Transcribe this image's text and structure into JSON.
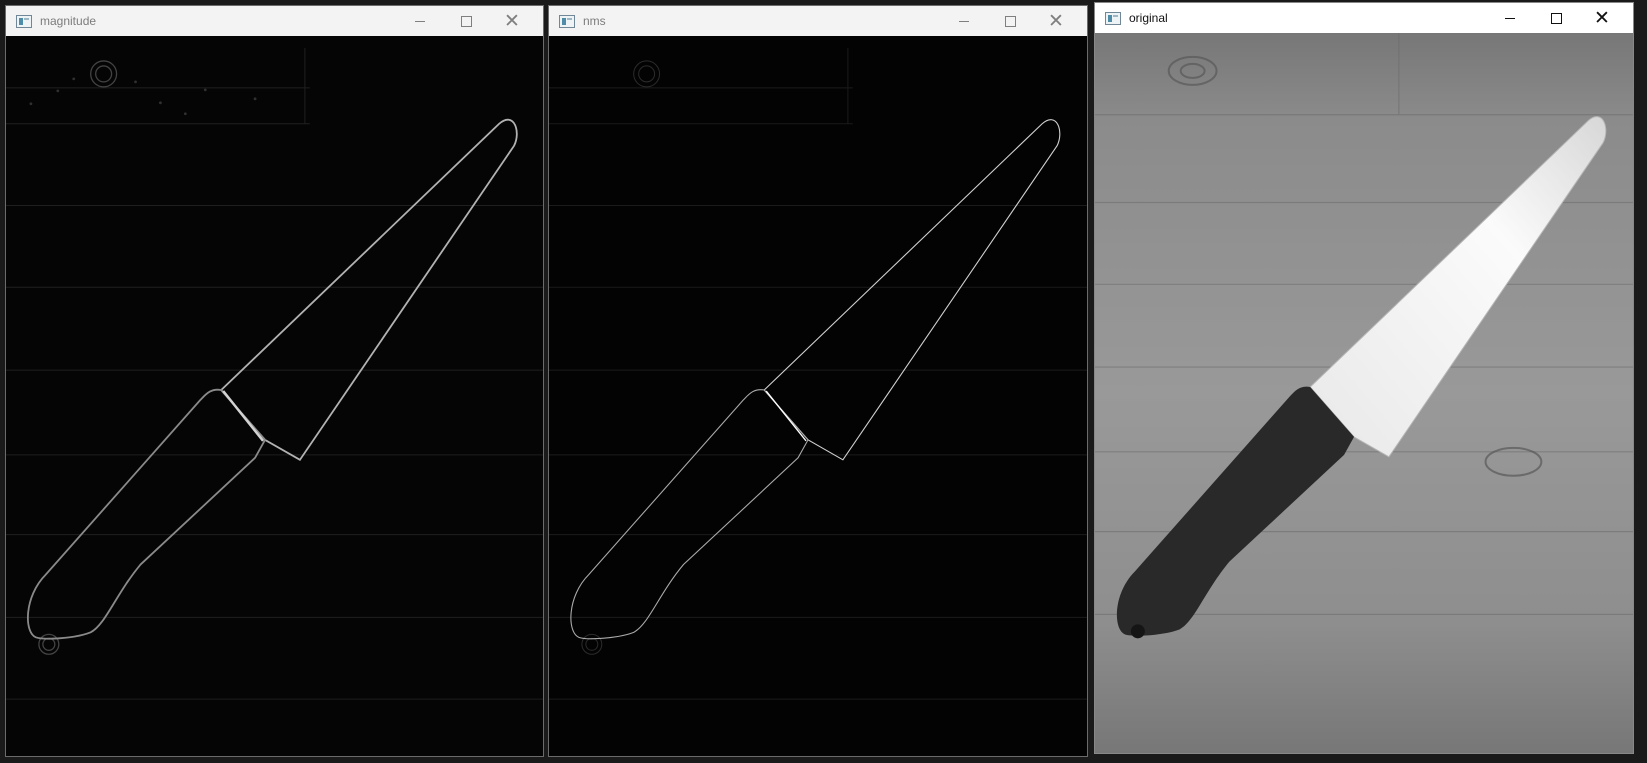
{
  "windows": [
    {
      "title": "magnitude",
      "controls": {
        "minimize": "–",
        "maximize": "□",
        "close": "✕"
      }
    },
    {
      "title": "nms",
      "controls": {
        "minimize": "–",
        "maximize": "□",
        "close": "✕"
      }
    },
    {
      "title": "original",
      "controls": {
        "minimize": "–",
        "maximize": "□",
        "close": "✕"
      }
    }
  ],
  "icons": {
    "app": "window-app-icon",
    "minimize": "minimize-icon",
    "maximize": "maximize-icon",
    "close": "close-icon"
  },
  "colors": {
    "titlebar_inactive": "#f3f3f3",
    "titlebar_active": "#ffffff",
    "edge_background": "#050505",
    "edge_stroke": "#a8a8a8",
    "wood_gray": "#8d8d8d",
    "blade": "#f2f2f2",
    "handle": "#2b2b2b"
  }
}
